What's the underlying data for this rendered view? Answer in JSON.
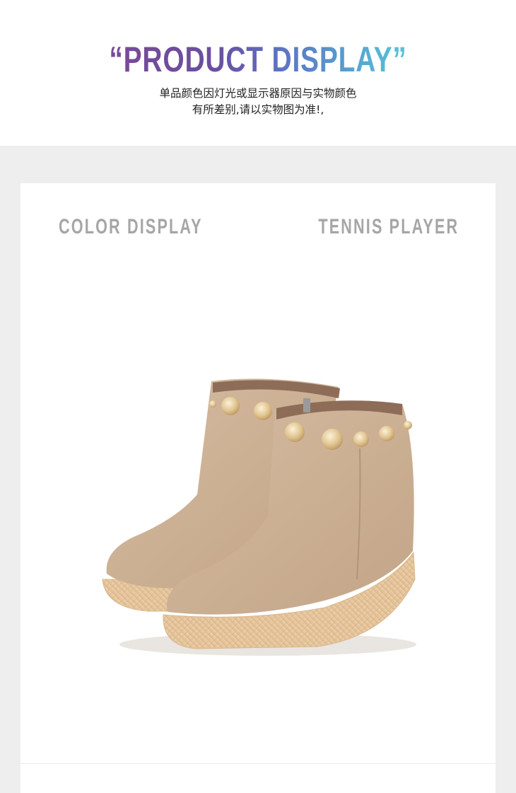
{
  "header": {
    "title": "“PRODUCT DISPLAY”",
    "subtitle_line1": "单品颜色因灯光或显示器原因与实物颜色",
    "subtitle_line2": "有所差别,请以实物图为准!,"
  },
  "card": {
    "left_label": "COLOR DISPLAY",
    "right_label": "TENNIS PLAYER",
    "product_image": "suede-wedge-ankle-boots-with-gold-studs"
  },
  "colors": {
    "page_bg": "#ffffff",
    "band_bg": "#eeeeee",
    "label_gray": "#a6a6a6",
    "title_gradient_start": "#7a4a97",
    "title_gradient_end": "#55c6d8",
    "boot_suede": "#cdb297",
    "boot_sole": "#e9c9a1",
    "stud_gold": "#e2c48d"
  }
}
